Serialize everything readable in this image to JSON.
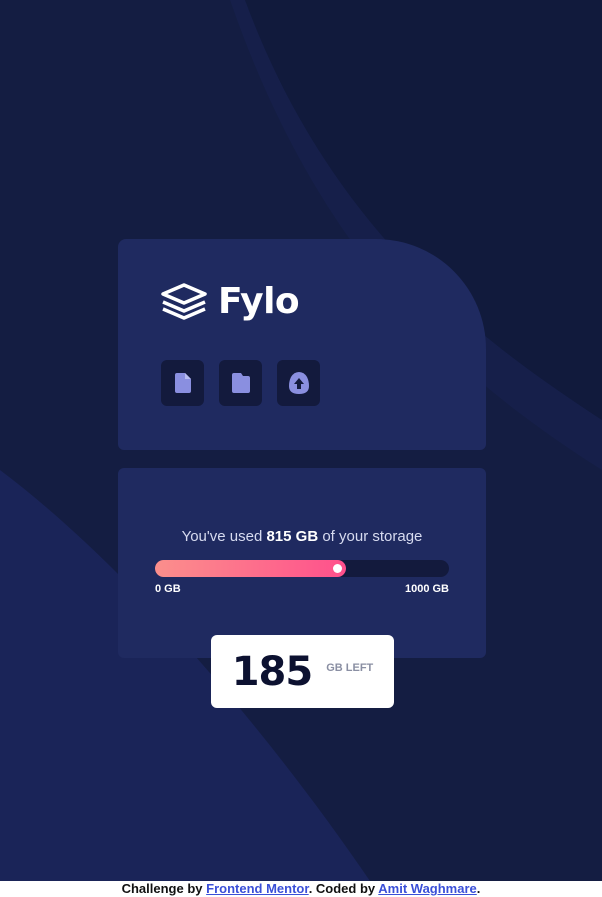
{
  "app": {
    "logo_text": "Fylo",
    "icons": [
      "document-icon",
      "folder-icon",
      "upload-icon"
    ]
  },
  "usage": {
    "prefix": "You've used",
    "amount": "815 GB",
    "suffix": "of your storage",
    "progress_percent": 65,
    "scale_min": "0 GB",
    "scale_max": "1000 GB"
  },
  "remaining": {
    "value": "185",
    "unit": "GB LEFT"
  },
  "footer": {
    "prefix": "Challenge by",
    "link1": "Frontend Mentor",
    "middle": ". Coded by",
    "link2": "Amit Waghmare",
    "suffix": "."
  },
  "colors": {
    "background": "#141d42",
    "card": "#1f2a60",
    "gradient_start": "#fb8f8c",
    "gradient_end": "#ff508c",
    "icon": "#8a8fe0"
  }
}
